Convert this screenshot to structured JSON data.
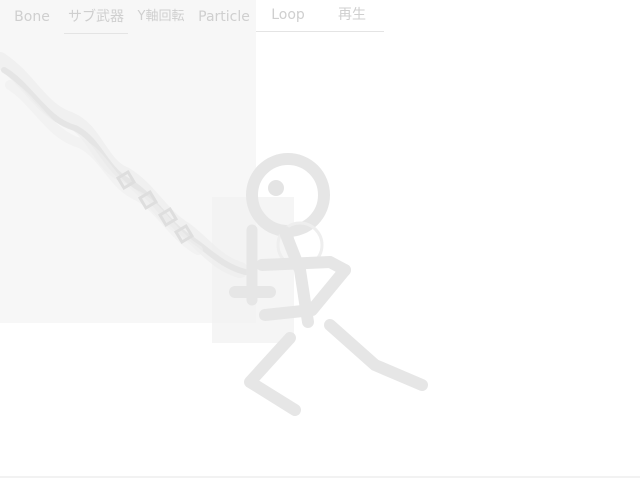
{
  "toolbar": {
    "tabs": [
      {
        "id": "bone",
        "label": "Bone"
      },
      {
        "id": "sub_weapon",
        "label": "サブ武器"
      },
      {
        "id": "y_rotation",
        "label": "Y軸回転"
      },
      {
        "id": "particle",
        "label": "Particle"
      },
      {
        "id": "loop",
        "label": "Loop"
      },
      {
        "id": "play",
        "label": "再生"
      }
    ]
  },
  "colors": {
    "background": "#ffffff",
    "panel": "#f7f7f7",
    "tab_text": "#cfcfcf",
    "figure_stroke": "#e6e6e6"
  },
  "canvas": {
    "content": "stick-figure-animation-preview"
  }
}
